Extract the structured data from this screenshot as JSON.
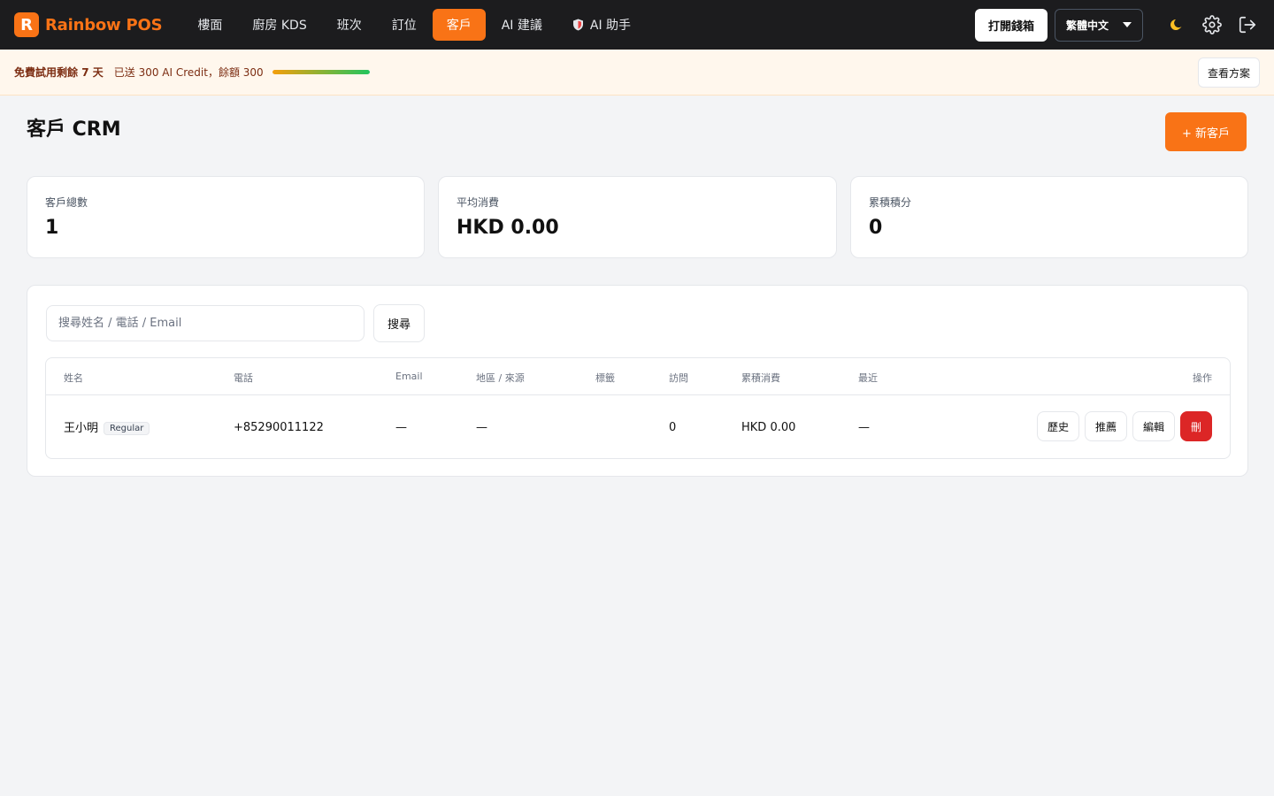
{
  "app": {
    "name": "Rainbow POS",
    "logo_letter": "R"
  },
  "nav": {
    "items": [
      {
        "label": "樓面",
        "active": false
      },
      {
        "label": "廚房 KDS",
        "active": false
      },
      {
        "label": "班次",
        "active": false
      },
      {
        "label": "訂位",
        "active": false
      },
      {
        "label": "客戶",
        "active": true
      },
      {
        "label": "AI 建議",
        "active": false
      },
      {
        "label": "AI 助手",
        "active": false,
        "icon": "shield-icon"
      }
    ],
    "open_drawer_label": "打開錢箱",
    "language": "繁體中文",
    "icons": [
      "moon-icon",
      "gear-icon",
      "logout-icon"
    ]
  },
  "banner": {
    "trial_prefix": "免費試用剩餘",
    "trial_days": "7",
    "trial_suffix": "天",
    "credit_text": "已送 300 AI Credit，餘額 300",
    "credit_fraction": 1.0,
    "plan_button": "查看方案"
  },
  "page": {
    "title": "客戶 CRM",
    "new_button": "+ 新客戶"
  },
  "stats": [
    {
      "label": "客戶總數",
      "value": "1"
    },
    {
      "label": "平均消費",
      "value": "HKD 0.00"
    },
    {
      "label": "累積積分",
      "value": "0"
    }
  ],
  "search": {
    "placeholder": "搜尋姓名 / 電話 / Email",
    "value": "",
    "button": "搜尋"
  },
  "table": {
    "headers": [
      "姓名",
      "電話",
      "Email",
      "地區 / 來源",
      "標籤",
      "訪問",
      "累積消費",
      "最近",
      "操作"
    ],
    "rows": [
      {
        "name": "王小明",
        "tier": "Regular",
        "phone": "+85290011122",
        "email": "—",
        "region": "—",
        "tags": "",
        "visits": "0",
        "spent": "HKD 0.00",
        "recent": "—",
        "actions": [
          "歷史",
          "推薦",
          "編輯",
          "刪"
        ]
      }
    ]
  },
  "colors": {
    "accent": "#f97316",
    "danger": "#dc2626",
    "topbar": "#1c1c1e",
    "banner": "#fff7ed"
  }
}
